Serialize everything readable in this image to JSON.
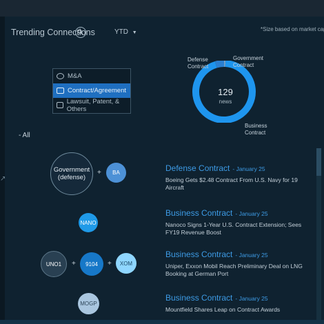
{
  "header": {
    "title": "Trending Connections",
    "period": "YTD",
    "note": "*Size based on market cap"
  },
  "filters": [
    {
      "label": "M&A",
      "icon": "merger-icon",
      "active": false
    },
    {
      "label": "Contract/Agreement",
      "icon": "contract-icon",
      "active": true
    },
    {
      "label": "Lawsuit, Patent, & Others",
      "icon": "lawsuit-icon",
      "active": false
    }
  ],
  "donut": {
    "count": "129",
    "sub": "news",
    "labels": {
      "defense": "Defense\nContract",
      "government": "Government\nContract",
      "business": "Business\nContract"
    },
    "segments": [
      {
        "name": "Defense Contract",
        "value": 6,
        "color": "#2b7fd0"
      },
      {
        "name": "Government Contract",
        "value": 1,
        "color": "#6f9fc9"
      },
      {
        "name": "Business Contract",
        "value": 122,
        "color": "#1e95ee"
      }
    ]
  },
  "all_toggle": "- All",
  "connections": [
    {
      "nodes": [
        "Government\n(defense)",
        "BA"
      ],
      "headline": "Defense Contract",
      "date": "- January 25",
      "body": "Boeing Gets $2.48 Contract From U.S. Navy for 19 Aircraft"
    },
    {
      "nodes": [
        "NANO"
      ],
      "headline": "Business Contract",
      "date": "- January 25",
      "body": "Nanoco Signs 1-Year U.S. Contract Extension; Sees FY19 Revenue Boost"
    },
    {
      "nodes": [
        "UNO1",
        "9104",
        "XOM"
      ],
      "headline": "Business Contract",
      "date": "- January 25",
      "body": "Uniper, Exxon Mobil Reach Preliminary Deal on LNG Booking at German Port"
    },
    {
      "nodes": [
        "MOGP"
      ],
      "headline": "Business Contract",
      "date": "- January 25",
      "body": "Mountfield Shares Leap on Contract Awards"
    }
  ],
  "colors": {
    "accent": "#3d9be5",
    "active_filter": "#1f6fc0",
    "background": "#0f2230"
  }
}
